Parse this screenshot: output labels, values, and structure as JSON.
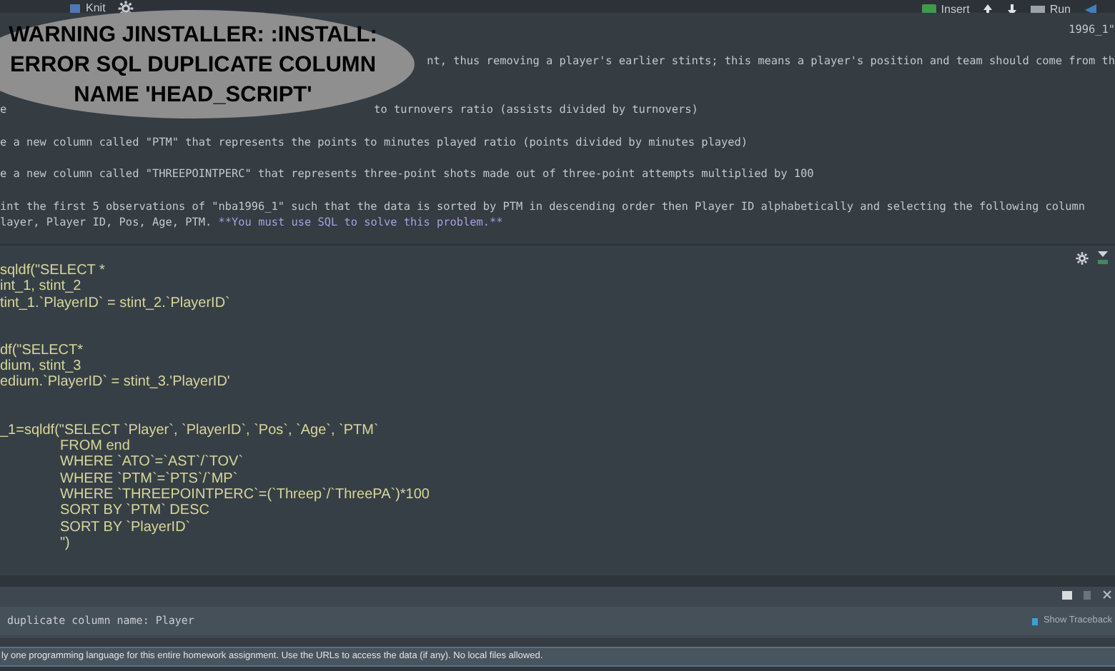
{
  "toolbar": {
    "left": [
      {
        "kind": "knit",
        "label": "Knit"
      },
      {
        "kind": "gear"
      }
    ],
    "right": [
      {
        "kind": "insert",
        "label": "Insert"
      },
      {
        "kind": "up"
      },
      {
        "kind": "down"
      },
      {
        "kind": "run",
        "label": "Run"
      },
      {
        "kind": "more"
      }
    ]
  },
  "banner": {
    "lines": [
      "WARNING JINSTALLER: :INSTALL:",
      "ERROR SQL DUPLICATE COLUMN",
      "NAME 'HEAD_SCRIPT'"
    ]
  },
  "markdown": [
    {
      "kind": "top",
      "after": "1996_1\""
    },
    {
      "kind": "top",
      "after": "nt, thus removing a player's earlier stints; this means a player's position and team should come from th"
    },
    {
      "kind": "lower",
      "before": "e",
      "after": "to turnovers ratio (assists divided by turnovers)"
    },
    {
      "kind": "plain",
      "text": "e a new column called \"PTM\" that represents the points to minutes played ratio (points divided by minutes played)"
    },
    {
      "kind": "plain",
      "text": "e a new column called \"THREEPOINTPERC\" that represents three-point shots made out of three-point attempts multiplied by 100"
    },
    {
      "kind": "plain",
      "text": "int the first 5 observations of \"nba1996_1\" such that the data is sorted by PTM in descending order then Player ID alphabetically and selecting the following column"
    },
    {
      "kind": "plain",
      "text": "layer, Player ID, Pos, Age, PTM.",
      "emphasis": "**You must use SQL to solve this problem.**"
    }
  ],
  "code_blocks": [
    [
      "sqldf(\"SELECT *",
      "int_1, stint_2",
      "tint_1.`PlayerID` = stint_2.`PlayerID`"
    ],
    [
      "df(\"SELECT*",
      "dium, stint_3",
      "edium.`PlayerID` = stint_3.'PlayerID'"
    ],
    [
      "_1=sqldf(\"SELECT `Player`, `PlayerID`, `Pos`, `Age`, `PTM`",
      "FROM end",
      "WHERE `ATO`=`AST`/`TOV`",
      "WHERE `PTM`=`PTS`/`MP`",
      "WHERE `THREEPOINTPERC`=(`Threep`/`ThreePA`)*100",
      "SORT BY `PTM` DESC",
      "SORT BY `PlayerID`",
      "\")"
    ]
  ],
  "error": {
    "message": "duplicate column name: Player",
    "traceback_link": "Show Traceback"
  },
  "status_bar": {
    "text": "ly one programming language for this entire homework assignment. Use the URLs to access the data (if any). No local files allowed."
  }
}
